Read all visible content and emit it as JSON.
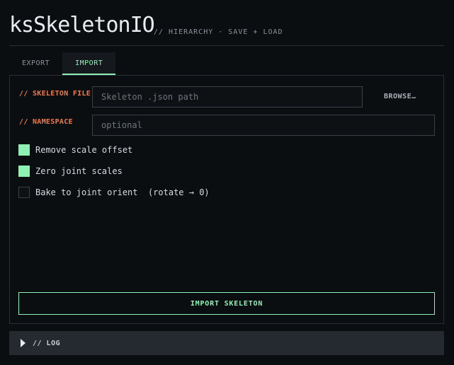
{
  "app": {
    "title": "ksSkeletonIO",
    "subtitle": "// HIERARCHY · SAVE + LOAD"
  },
  "tabs": [
    {
      "label": "EXPORT",
      "active": false
    },
    {
      "label": "IMPORT",
      "active": true
    }
  ],
  "import": {
    "skeleton_file_label": "// SKELETON FILE",
    "skeleton_file_placeholder": "Skeleton .json path",
    "skeleton_file_value": "",
    "browse_label": "BROWSE…",
    "namespace_label": "// NAMESPACE",
    "namespace_placeholder": "optional",
    "namespace_value": "",
    "options": [
      {
        "label": "Remove scale offset",
        "checked": true
      },
      {
        "label": "Zero joint scales",
        "checked": true
      },
      {
        "label": "Bake to joint orient  (rotate → 0)",
        "checked": false
      }
    ],
    "import_button_label": "IMPORT SKELETON"
  },
  "log": {
    "label": "// LOG",
    "expanded": false
  },
  "colors": {
    "accent": "#8ef0b4",
    "label": "#f07a4a",
    "background": "#0b0e11"
  }
}
